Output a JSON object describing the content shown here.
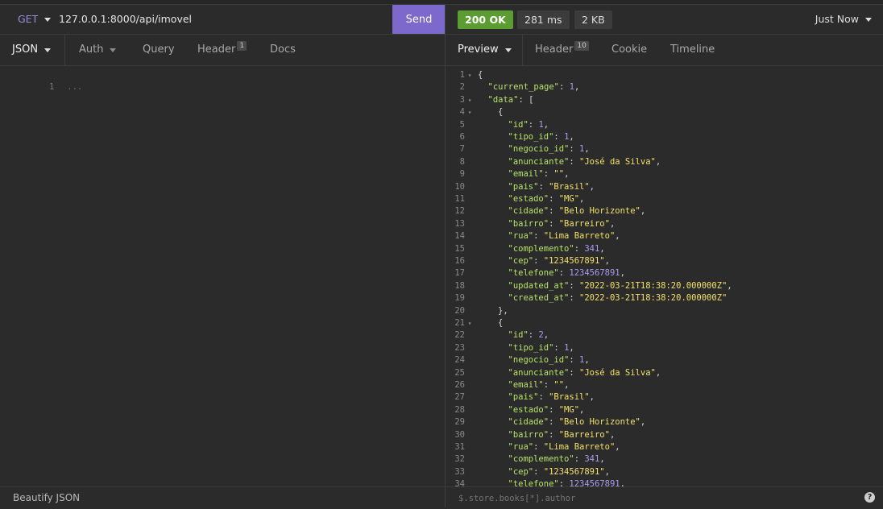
{
  "request": {
    "method": "GET",
    "url": "127.0.0.1:8000/api/imovel",
    "send_label": "Send",
    "tabs": [
      {
        "label": "JSON",
        "badge": ""
      },
      {
        "label": "Auth",
        "badge": ""
      },
      {
        "label": "Query",
        "badge": ""
      },
      {
        "label": "Header",
        "badge": "1"
      },
      {
        "label": "Docs",
        "badge": ""
      }
    ],
    "body_line_number": "1",
    "body_placeholder": "...",
    "footer_label": "Beautify JSON"
  },
  "response": {
    "status": "200 OK",
    "time": "281 ms",
    "size": "2 KB",
    "history": "Just Now",
    "tabs": [
      {
        "label": "Preview",
        "badge": ""
      },
      {
        "label": "Header",
        "badge": "10"
      },
      {
        "label": "Cookie",
        "badge": ""
      },
      {
        "label": "Timeline",
        "badge": ""
      }
    ],
    "filter_placeholder": "$.store.books[*].author",
    "help_icon": "?",
    "lines": [
      {
        "n": "1",
        "fold": true,
        "ind": 0,
        "tokens": [
          [
            "p",
            "{"
          ]
        ]
      },
      {
        "n": "2",
        "ind": 1,
        "tokens": [
          [
            "k",
            "\"current_page\""
          ],
          [
            "p",
            ": "
          ],
          [
            "n",
            "1"
          ],
          [
            "p",
            ","
          ]
        ]
      },
      {
        "n": "3",
        "fold": true,
        "ind": 1,
        "tokens": [
          [
            "k",
            "\"data\""
          ],
          [
            "p",
            ": ["
          ]
        ]
      },
      {
        "n": "4",
        "fold": true,
        "ind": 2,
        "tokens": [
          [
            "p",
            "{"
          ]
        ]
      },
      {
        "n": "5",
        "ind": 3,
        "tokens": [
          [
            "k",
            "\"id\""
          ],
          [
            "p",
            ": "
          ],
          [
            "n",
            "1"
          ],
          [
            "p",
            ","
          ]
        ]
      },
      {
        "n": "6",
        "ind": 3,
        "tokens": [
          [
            "k",
            "\"tipo_id\""
          ],
          [
            "p",
            ": "
          ],
          [
            "n",
            "1"
          ],
          [
            "p",
            ","
          ]
        ]
      },
      {
        "n": "7",
        "ind": 3,
        "tokens": [
          [
            "k",
            "\"negocio_id\""
          ],
          [
            "p",
            ": "
          ],
          [
            "n",
            "1"
          ],
          [
            "p",
            ","
          ]
        ]
      },
      {
        "n": "8",
        "ind": 3,
        "tokens": [
          [
            "k",
            "\"anunciante\""
          ],
          [
            "p",
            ": "
          ],
          [
            "s",
            "\"José da Silva\""
          ],
          [
            "p",
            ","
          ]
        ]
      },
      {
        "n": "9",
        "ind": 3,
        "tokens": [
          [
            "k",
            "\"email\""
          ],
          [
            "p",
            ": "
          ],
          [
            "s",
            "\"\""
          ],
          [
            "p",
            ","
          ]
        ]
      },
      {
        "n": "10",
        "ind": 3,
        "tokens": [
          [
            "k",
            "\"pais\""
          ],
          [
            "p",
            ": "
          ],
          [
            "s",
            "\"Brasil\""
          ],
          [
            "p",
            ","
          ]
        ]
      },
      {
        "n": "11",
        "ind": 3,
        "tokens": [
          [
            "k",
            "\"estado\""
          ],
          [
            "p",
            ": "
          ],
          [
            "s",
            "\"MG\""
          ],
          [
            "p",
            ","
          ]
        ]
      },
      {
        "n": "12",
        "ind": 3,
        "tokens": [
          [
            "k",
            "\"cidade\""
          ],
          [
            "p",
            ": "
          ],
          [
            "s",
            "\"Belo Horizonte\""
          ],
          [
            "p",
            ","
          ]
        ]
      },
      {
        "n": "13",
        "ind": 3,
        "tokens": [
          [
            "k",
            "\"bairro\""
          ],
          [
            "p",
            ": "
          ],
          [
            "s",
            "\"Barreiro\""
          ],
          [
            "p",
            ","
          ]
        ]
      },
      {
        "n": "14",
        "ind": 3,
        "tokens": [
          [
            "k",
            "\"rua\""
          ],
          [
            "p",
            ": "
          ],
          [
            "s",
            "\"Lima Barreto\""
          ],
          [
            "p",
            ","
          ]
        ]
      },
      {
        "n": "15",
        "ind": 3,
        "tokens": [
          [
            "k",
            "\"complemento\""
          ],
          [
            "p",
            ": "
          ],
          [
            "n",
            "341"
          ],
          [
            "p",
            ","
          ]
        ]
      },
      {
        "n": "16",
        "ind": 3,
        "tokens": [
          [
            "k",
            "\"cep\""
          ],
          [
            "p",
            ": "
          ],
          [
            "s",
            "\"1234567891\""
          ],
          [
            "p",
            ","
          ]
        ]
      },
      {
        "n": "17",
        "ind": 3,
        "tokens": [
          [
            "k",
            "\"telefone\""
          ],
          [
            "p",
            ": "
          ],
          [
            "n",
            "1234567891"
          ],
          [
            "p",
            ","
          ]
        ]
      },
      {
        "n": "18",
        "ind": 3,
        "tokens": [
          [
            "k",
            "\"updated_at\""
          ],
          [
            "p",
            ": "
          ],
          [
            "s",
            "\"2022-03-21T18:38:20.000000Z\""
          ],
          [
            "p",
            ","
          ]
        ]
      },
      {
        "n": "19",
        "ind": 3,
        "tokens": [
          [
            "k",
            "\"created_at\""
          ],
          [
            "p",
            ": "
          ],
          [
            "s",
            "\"2022-03-21T18:38:20.000000Z\""
          ]
        ]
      },
      {
        "n": "20",
        "ind": 2,
        "tokens": [
          [
            "p",
            "},"
          ]
        ]
      },
      {
        "n": "21",
        "fold": true,
        "ind": 2,
        "tokens": [
          [
            "p",
            "{"
          ]
        ]
      },
      {
        "n": "22",
        "ind": 3,
        "tokens": [
          [
            "k",
            "\"id\""
          ],
          [
            "p",
            ": "
          ],
          [
            "n",
            "2"
          ],
          [
            "p",
            ","
          ]
        ]
      },
      {
        "n": "23",
        "ind": 3,
        "tokens": [
          [
            "k",
            "\"tipo_id\""
          ],
          [
            "p",
            ": "
          ],
          [
            "n",
            "1"
          ],
          [
            "p",
            ","
          ]
        ]
      },
      {
        "n": "24",
        "ind": 3,
        "tokens": [
          [
            "k",
            "\"negocio_id\""
          ],
          [
            "p",
            ": "
          ],
          [
            "n",
            "1"
          ],
          [
            "p",
            ","
          ]
        ]
      },
      {
        "n": "25",
        "ind": 3,
        "tokens": [
          [
            "k",
            "\"anunciante\""
          ],
          [
            "p",
            ": "
          ],
          [
            "s",
            "\"José da Silva\""
          ],
          [
            "p",
            ","
          ]
        ]
      },
      {
        "n": "26",
        "ind": 3,
        "tokens": [
          [
            "k",
            "\"email\""
          ],
          [
            "p",
            ": "
          ],
          [
            "s",
            "\"\""
          ],
          [
            "p",
            ","
          ]
        ]
      },
      {
        "n": "27",
        "ind": 3,
        "tokens": [
          [
            "k",
            "\"pais\""
          ],
          [
            "p",
            ": "
          ],
          [
            "s",
            "\"Brasil\""
          ],
          [
            "p",
            ","
          ]
        ]
      },
      {
        "n": "28",
        "ind": 3,
        "tokens": [
          [
            "k",
            "\"estado\""
          ],
          [
            "p",
            ": "
          ],
          [
            "s",
            "\"MG\""
          ],
          [
            "p",
            ","
          ]
        ]
      },
      {
        "n": "29",
        "ind": 3,
        "tokens": [
          [
            "k",
            "\"cidade\""
          ],
          [
            "p",
            ": "
          ],
          [
            "s",
            "\"Belo Horizonte\""
          ],
          [
            "p",
            ","
          ]
        ]
      },
      {
        "n": "30",
        "ind": 3,
        "tokens": [
          [
            "k",
            "\"bairro\""
          ],
          [
            "p",
            ": "
          ],
          [
            "s",
            "\"Barreiro\""
          ],
          [
            "p",
            ","
          ]
        ]
      },
      {
        "n": "31",
        "ind": 3,
        "tokens": [
          [
            "k",
            "\"rua\""
          ],
          [
            "p",
            ": "
          ],
          [
            "s",
            "\"Lima Barreto\""
          ],
          [
            "p",
            ","
          ]
        ]
      },
      {
        "n": "32",
        "ind": 3,
        "tokens": [
          [
            "k",
            "\"complemento\""
          ],
          [
            "p",
            ": "
          ],
          [
            "n",
            "341"
          ],
          [
            "p",
            ","
          ]
        ]
      },
      {
        "n": "33",
        "ind": 3,
        "tokens": [
          [
            "k",
            "\"cep\""
          ],
          [
            "p",
            ": "
          ],
          [
            "s",
            "\"1234567891\""
          ],
          [
            "p",
            ","
          ]
        ]
      },
      {
        "n": "34",
        "ind": 3,
        "tokens": [
          [
            "k",
            "\"telefone\""
          ],
          [
            "p",
            ": "
          ],
          [
            "n",
            "1234567891"
          ],
          [
            "p",
            ","
          ]
        ]
      }
    ]
  }
}
